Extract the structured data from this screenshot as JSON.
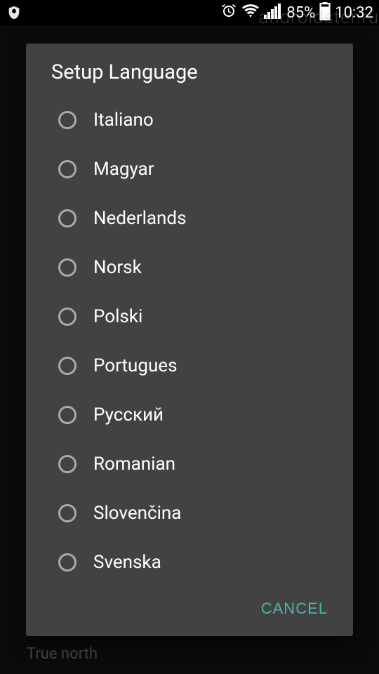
{
  "status": {
    "battery": "85%",
    "time": "10:32"
  },
  "watermark": "androidster.ru",
  "background": {
    "true_north": "True north"
  },
  "dialog": {
    "title": "Setup Language",
    "options": [
      "Italiano",
      "Magyar",
      "Nederlands",
      "Norsk",
      "Polski",
      "Portugues",
      "Русский",
      "Romanian",
      "Slovenčina",
      "Svenska"
    ],
    "cancel": "CANCEL"
  }
}
